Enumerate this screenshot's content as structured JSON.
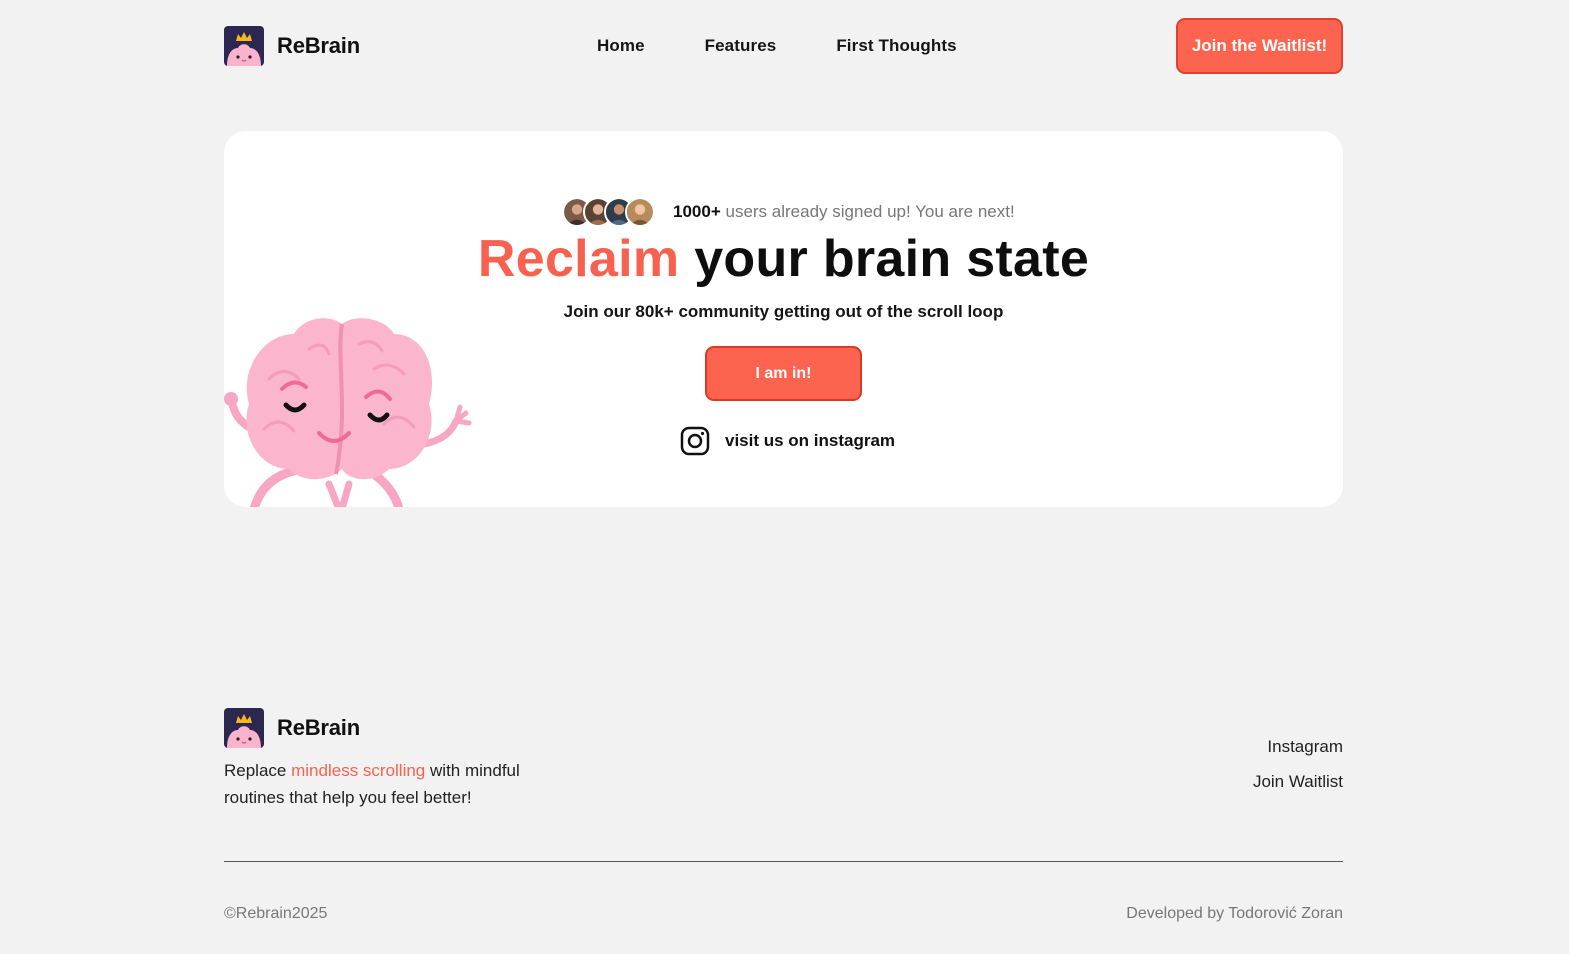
{
  "brand": {
    "name": "ReBrain",
    "logo_icon": "brain-king-icon",
    "accent_color": "#fd6450"
  },
  "nav": {
    "items": [
      {
        "label": "Home"
      },
      {
        "label": "Features"
      },
      {
        "label": "First Thoughts"
      }
    ],
    "cta_label": "Join the Waitlist!"
  },
  "hero": {
    "proof_count": "1000+",
    "proof_text": "users already signed up! You are next!",
    "title_accent": "Reclaim",
    "title_rest": "your brain state",
    "subtitle": "Join our 80k+ community getting out of the scroll loop",
    "cta_label": "I am in!",
    "instagram_label": "visit us on instagram",
    "instagram_icon": "instagram-icon",
    "mascot": "brain-mascot"
  },
  "footer": {
    "brand_name": "ReBrain",
    "desc_before": "Replace",
    "desc_highlight": "mindless scrolling",
    "desc_after": "with mindful routines that help you feel better!",
    "links": [
      {
        "label": "Instagram"
      },
      {
        "label": "Join Waitlist"
      }
    ],
    "copyright": "©Rebrain2025",
    "credit": "Developed by Todorović Zoran"
  }
}
